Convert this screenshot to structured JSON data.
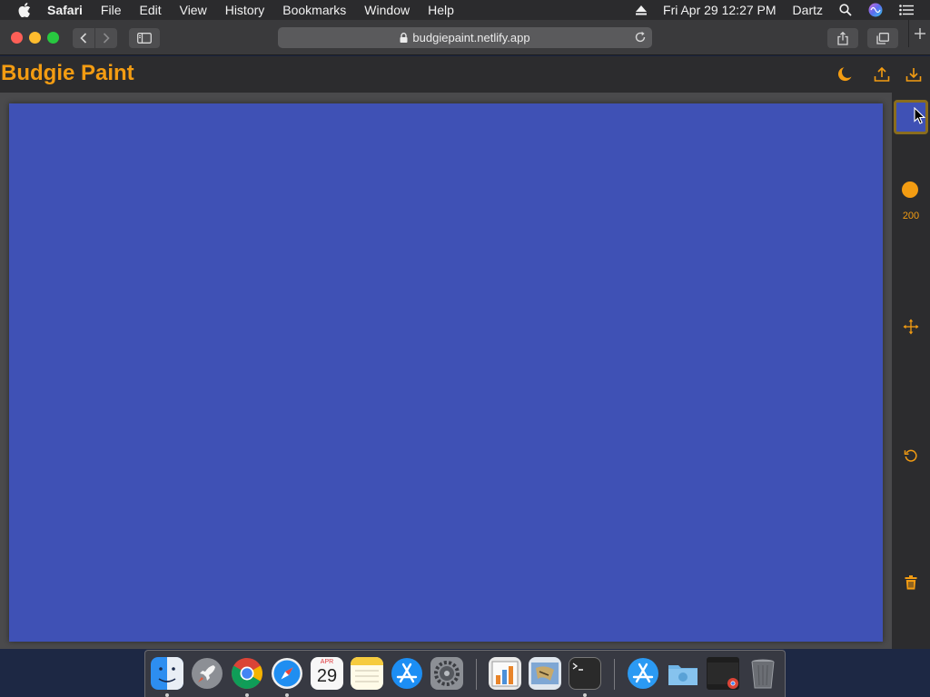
{
  "menubar": {
    "app_name": "Safari",
    "menus": [
      "File",
      "Edit",
      "View",
      "History",
      "Bookmarks",
      "Window",
      "Help"
    ],
    "datetime": "Fri Apr 29  12:27 PM",
    "user": "Dartz",
    "icons": [
      "apple-icon",
      "eject-icon",
      "spotlight-search-icon",
      "siri-icon",
      "control-center-icon"
    ]
  },
  "browser": {
    "url": "budgiepaint.netlify.app",
    "icons": [
      "back-icon",
      "forward-icon",
      "sidebar-icon",
      "lock-icon",
      "reload-icon",
      "share-icon",
      "tabs-icon",
      "new-tab-icon"
    ]
  },
  "app": {
    "title": "Budgie Paint",
    "accent_color": "#f39c12",
    "header_icons": [
      "dark-mode-moon-icon",
      "upload-icon",
      "download-icon"
    ]
  },
  "canvas": {
    "fill_color": "#3f51b5"
  },
  "sidebar": {
    "selected_color": "#3f51b5",
    "brush_size": "200",
    "icons": [
      "brush-size-icon",
      "move-icon",
      "reset-icon",
      "trash-icon"
    ]
  },
  "dock": {
    "apps": [
      "Finder",
      "Launchpad",
      "Google Chrome",
      "Safari",
      "Calendar",
      "Notes",
      "App Store",
      "System Preferences",
      "Numbers",
      "Mail",
      "Terminal",
      "App Store",
      "Downloads",
      "Chrome Window",
      "Trash"
    ],
    "calendar_month": "APR",
    "calendar_day": "29"
  }
}
